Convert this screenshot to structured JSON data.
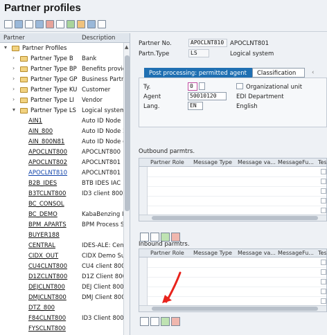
{
  "window": {
    "title": "Partner profiles"
  },
  "toolbar": {
    "icons": [
      "new-icon",
      "edit-icon",
      "copy-icon",
      "delete-icon",
      "trash-icon",
      "check-icon",
      "tree-icon",
      "expand-icon",
      "save-icon",
      "print-icon"
    ]
  },
  "tree": {
    "headers": {
      "partner": "Partner",
      "description": "Description"
    },
    "root": {
      "label": "Partner Profiles"
    },
    "types": [
      {
        "label": "Partner Type B",
        "desc": "Bank"
      },
      {
        "label": "Partner Type BP",
        "desc": "Benefits provide"
      },
      {
        "label": "Partner Type GP",
        "desc": "Business Partner"
      },
      {
        "label": "Partner Type KU",
        "desc": "Customer"
      },
      {
        "label": "Partner Type LI",
        "desc": "Vendor"
      },
      {
        "label": "Partner Type LS",
        "desc": "Logical system"
      }
    ],
    "leaves": [
      {
        "label": "AIN1",
        "desc": "Auto ID Node 1"
      },
      {
        "label": "AIN_800",
        "desc": "Auto ID Node 2"
      },
      {
        "label": "AIN_800N81",
        "desc": "Auto ID Node cl"
      },
      {
        "label": "APOCLNT800",
        "desc": "APOCLNT800"
      },
      {
        "label": "APOCLNT802",
        "desc": "APOCLNT801"
      },
      {
        "label": "APOCLNT810",
        "desc": "APOCLNT801"
      },
      {
        "label": "B2B_IDES",
        "desc": "BTB IDES IAC"
      },
      {
        "label": "B3TCLNT800",
        "desc": "ID3 client  800"
      },
      {
        "label": "BC_CONSOL",
        "desc": ""
      },
      {
        "label": "BC_DEMO",
        "desc": "KabaBenzing In"
      },
      {
        "label": "BPM_APARTS",
        "desc": "BPM Process Sa"
      },
      {
        "label": "BUYER188",
        "desc": ""
      },
      {
        "label": "CENTRAL",
        "desc": "IDES-ALE: Centr"
      },
      {
        "label": "CIDX_OUT",
        "desc": "CIDX Demo Sup"
      },
      {
        "label": "CU4CLNT800",
        "desc": "CU4 client 800"
      },
      {
        "label": "D1ZCLNT800",
        "desc": "D1Z Client 800"
      },
      {
        "label": "DEJCLNT800",
        "desc": "DEJ Client 800 -"
      },
      {
        "label": "DMJCLNT800",
        "desc": "DMJ Client 800"
      },
      {
        "label": "DTZ_800",
        "desc": ""
      },
      {
        "label": "F84CLNT800",
        "desc": "ID3 Client 800"
      },
      {
        "label": "FYSCLNT800",
        "desc": ""
      }
    ]
  },
  "detail": {
    "partner_no_label": "Partner No.",
    "partner_no_value": "APOCLNT810",
    "partner_no_desc": "APOCLNT801",
    "partn_type_label": "Partn.Type",
    "partn_type_value": "LS",
    "partn_type_desc": "Logical system",
    "tabs": [
      "Post processing: permitted agent",
      "Classification"
    ],
    "ty_label": "Ty.",
    "ty_value": "0",
    "org_unit_label": "Organizational unit",
    "agent_label": "Agent",
    "agent_value": "50010120",
    "agent_desc": "EDI Department",
    "lang_label": "Lang.",
    "lang_value": "EN",
    "lang_desc": "English",
    "outbound_title": "Outbound parmtrs.",
    "inbound_title": "Inbound parmtrs.",
    "grid_columns": [
      "Partner Role",
      "Message Type",
      "Message va...",
      "MessageFu...",
      "Tes"
    ]
  }
}
